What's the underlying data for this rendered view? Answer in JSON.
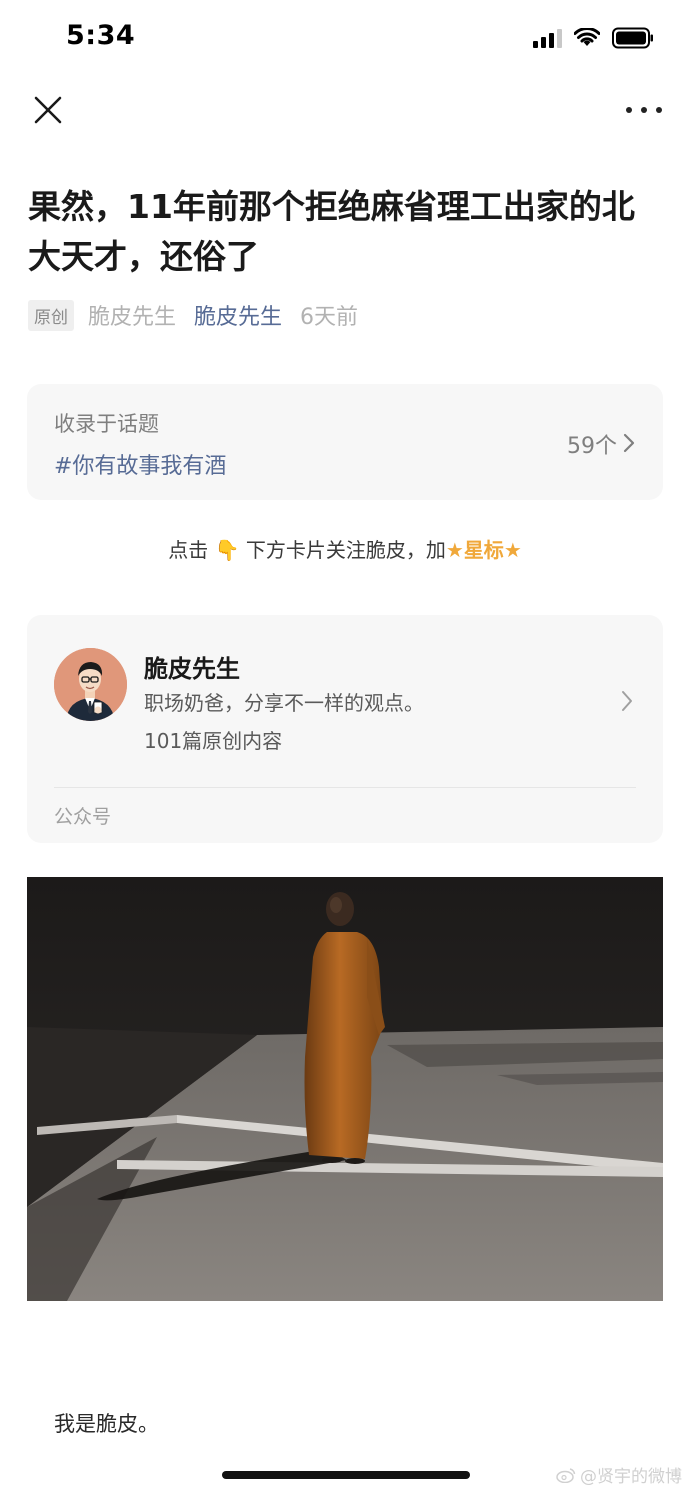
{
  "status_bar": {
    "time": "5:34",
    "icons": [
      "signal-icon",
      "wifi-icon",
      "battery-icon"
    ]
  },
  "nav": {
    "close_icon": "close-icon",
    "more_icon": "more-dots-icon"
  },
  "article": {
    "title": "果然，11年前那个拒绝麻省理工出家的北大天才，还俗了",
    "badge": "原创",
    "author": "脆皮先生",
    "account": "脆皮先生",
    "time": "6天前",
    "body_first_line": "我是脆皮。"
  },
  "topic": {
    "label": "收录于话题",
    "tag": "#你有故事我有酒",
    "count": "59个"
  },
  "follow_prompt": {
    "prefix": "点击",
    "emoji": "👇",
    "middle": "下方卡片关注脆皮，加",
    "star_left": "★",
    "highlight": "星标",
    "star_right": "★"
  },
  "profile_card": {
    "name": "脆皮先生",
    "description": "职场奶爸，分享不一样的观点。",
    "article_count": "101篇原创内容",
    "type": "公众号"
  },
  "watermark": {
    "text": "@贤宇的微博"
  },
  "colors": {
    "link_blue": "#576b95",
    "star_orange": "#f0a83a",
    "card_bg": "#f7f7f7",
    "avatar_bg": "#e0977a"
  }
}
